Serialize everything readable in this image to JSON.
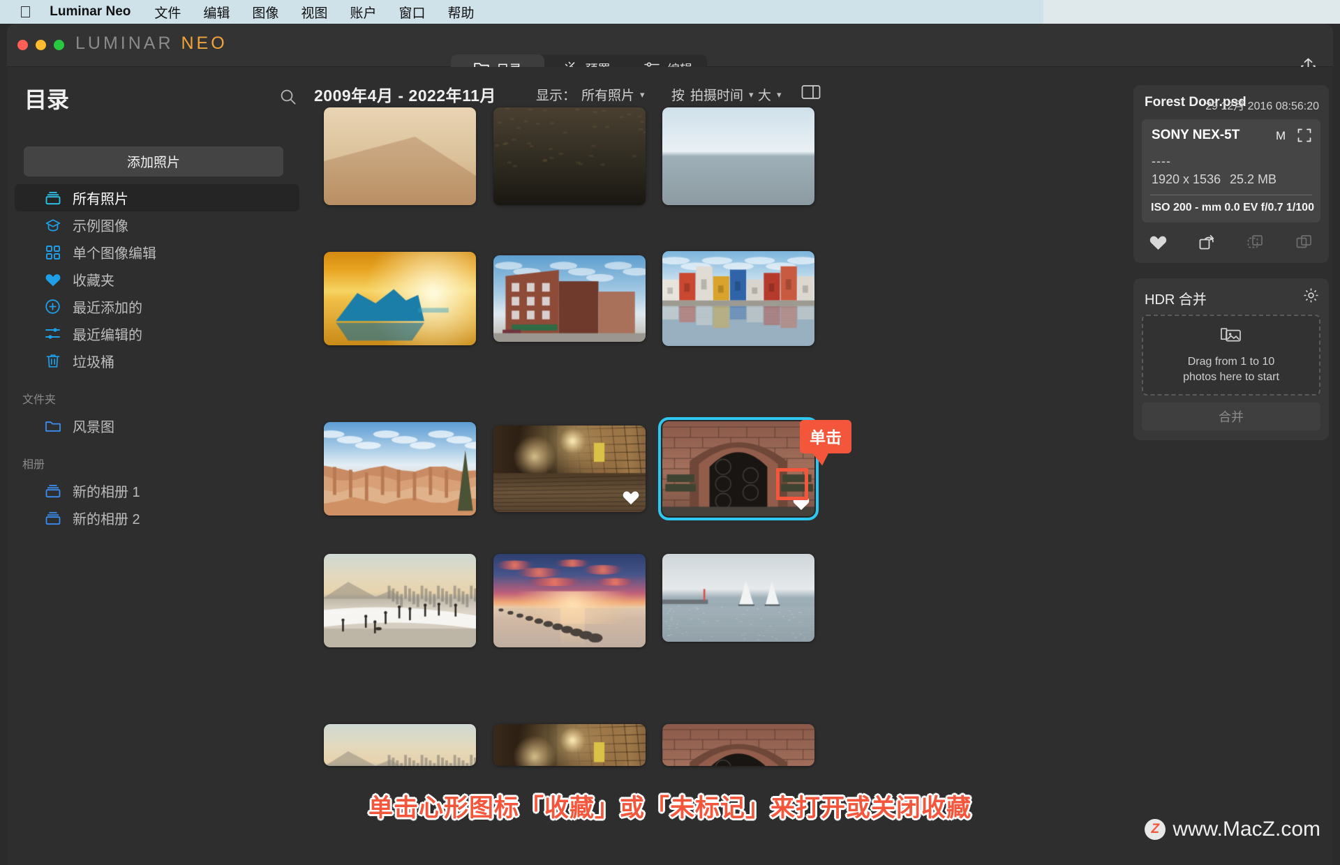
{
  "menubar": {
    "apple_icon": "apple-logo-icon",
    "app_name": "Luminar Neo",
    "items": [
      "文件",
      "编辑",
      "图像",
      "视图",
      "账户",
      "窗口",
      "帮助"
    ]
  },
  "titlebar": {
    "brand_lum": "LUMINAR",
    "brand_neo": "NEO",
    "share_icon": "share-upload-icon",
    "modes": [
      {
        "label": "目录",
        "icon": "folder-icon",
        "active": true
      },
      {
        "label": "预置",
        "icon": "sparkle-icon",
        "active": false
      },
      {
        "label": "编辑",
        "icon": "sliders-icon",
        "active": false
      }
    ]
  },
  "sidebar": {
    "title": "目录",
    "search_icon": "search-icon",
    "add_photos_label": "添加照片",
    "items": [
      {
        "label": "所有照片",
        "icon": "catalog-icon",
        "selected": true
      },
      {
        "label": "示例图像",
        "icon": "graduation-cap-icon",
        "selected": false
      },
      {
        "label": "单个图像编辑",
        "icon": "grid-squares-icon",
        "selected": false
      },
      {
        "label": "收藏夹",
        "icon": "heart-icon",
        "selected": false
      },
      {
        "label": "最近添加的",
        "icon": "plus-circle-icon",
        "selected": false
      },
      {
        "label": "最近编辑的",
        "icon": "sliders-icon",
        "selected": false
      },
      {
        "label": "垃圾桶",
        "icon": "trash-icon",
        "selected": false
      }
    ],
    "folders_header": "文件夹",
    "folders": [
      {
        "label": "风景图",
        "icon": "folder-icon"
      }
    ],
    "albums_header": "相册",
    "albums": [
      {
        "label": "新的相册 1",
        "icon": "album-icon"
      },
      {
        "label": "新的相册 2",
        "icon": "album-icon"
      }
    ]
  },
  "filterbar": {
    "date_range": "2009年4月 - 2022年11月",
    "show_label": "显示：",
    "show_value": "所有照片",
    "sort_label": "按",
    "sort_value": "拍摄时间",
    "size_value": "大",
    "view_toggle_icon": "split-view-icon",
    "chevron_icon": "chevron-down-icon"
  },
  "grid": {
    "rows": [
      {
        "cells": [
          {
            "name": "desert-dune",
            "partial": true
          },
          {
            "name": "dark-ridge",
            "partial": true
          },
          {
            "name": "snow-horizon",
            "partial": true
          }
        ]
      },
      {
        "cells": [
          {
            "name": "iceberg-sunset",
            "favorite": false,
            "selected": false
          },
          {
            "name": "brick-town-street",
            "favorite": false,
            "selected": false
          },
          {
            "name": "colorful-canal-houses",
            "favorite": false,
            "selected": false
          }
        ]
      },
      {
        "cells": [
          {
            "name": "canyon-hoodoos",
            "favorite": false,
            "selected": false
          },
          {
            "name": "night-alley",
            "favorite": true,
            "selected": false
          },
          {
            "name": "forest-door",
            "favorite": true,
            "selected": true
          }
        ]
      },
      {
        "cells": [
          {
            "name": "beach-walkers",
            "favorite": false,
            "selected": false
          },
          {
            "name": "sunset-breakwater",
            "favorite": false,
            "selected": false
          },
          {
            "name": "sailboats-sea",
            "favorite": false,
            "selected": false
          }
        ]
      }
    ]
  },
  "callout": {
    "label": "单击",
    "color": "#f4563c"
  },
  "info_panel": {
    "file_name": "Forest Door.psd",
    "date_taken": "29 12月 2016 08:56:20",
    "camera_model": "SONY NEX-5T",
    "shoot_mode": "M",
    "frame_icon": "crop-frame-icon",
    "lens": "----",
    "dimensions": "1920 x 1536",
    "file_size": "25.2 MB",
    "exif": [
      "ISO 200",
      "- mm",
      "0.0 EV",
      "f/0.7",
      "1/100"
    ],
    "actions": [
      {
        "icon": "heart-icon",
        "enabled": true
      },
      {
        "icon": "rotate-icon",
        "enabled": true
      },
      {
        "icon": "copy-dashed-icon",
        "enabled": false
      },
      {
        "icon": "copy-icon",
        "enabled": false
      }
    ]
  },
  "hdr_panel": {
    "title": "HDR 合并",
    "gear_icon": "gear-icon",
    "drop_icon": "photos-stack-icon",
    "drop_text": "Drag from 1 to 10\nphotos here to start",
    "drop_text_line1": "Drag from 1 to 10",
    "drop_text_line2": "photos here to start",
    "merge_label": "合并"
  },
  "caption": {
    "text": "单击心形图标「收藏」或「未标记」来打开或关闭收藏",
    "color": "#f4563c"
  },
  "watermark": {
    "badge": "Z",
    "text": "www.MacZ.com"
  },
  "colors": {
    "accent_blue": "#2fc6f0",
    "icon_blue": "#1e9fe8",
    "callout_red": "#f4563c",
    "window_bg": "#2e2e2e",
    "titlebar_bg": "#333333",
    "menubar_bg": "#cfe2ea"
  }
}
